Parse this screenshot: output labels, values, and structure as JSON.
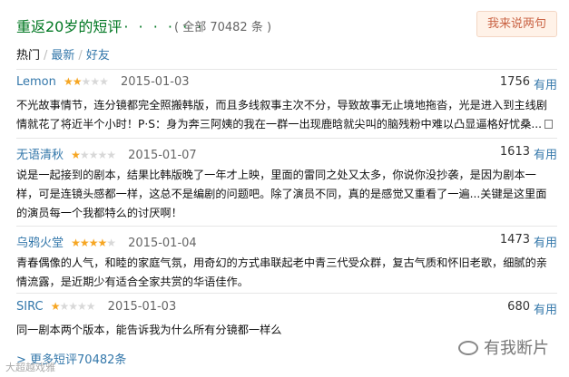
{
  "header": {
    "title": "重返20岁的短评",
    "dots": "· · · · · ·",
    "total": "( 全部 70482 条 )",
    "say_button": "我来说两句"
  },
  "sorts": {
    "hot": "热门",
    "sep": "/",
    "latest": "最新",
    "friends": "好友"
  },
  "comments": [
    {
      "user": "Lemon",
      "rating": 2,
      "date": "2015-01-03",
      "votes": "1756",
      "useful": "有用",
      "text": "不光故事情节，连分镜都完全照搬韩版，而且多线叙事主次不分，导致故事无止境地拖沓，光是进入到主线剧情就花了将近半个小时！P·S：身为奔三阿姨的我在一群一出现鹿晗就尖叫的脑残粉中难以凸显逼格好忧桑..."
    },
    {
      "user": "无语清秋",
      "rating": 1,
      "date": "2015-01-07",
      "votes": "1613",
      "useful": "有用",
      "text": "说是一起接到的剧本，结果比韩版晚了一年才上映，里面的雷同之处又太多，你说你没抄袭，是因为剧本一样，可是连镜头感都一样，这总不是编剧的问题吧。除了演员不同，真的是感觉又重看了一遍...关键是这里面的演员每一个我都特么的讨厌啊！"
    },
    {
      "user": "乌鸦火堂",
      "rating": 4,
      "date": "2015-01-04",
      "votes": "1473",
      "useful": "有用",
      "text": "青春偶像的人气，和睦的家庭气氛，用奇幻的方式串联起老中青三代受众群，复古气质和怀旧老歌，细腻的亲情流露，是近期少有适合全家共赏的华语佳作。"
    },
    {
      "user": "SIRC",
      "rating": 1,
      "date": "2015-01-03",
      "votes": "680",
      "useful": "有用",
      "text": "同一剧本两个版本，能告诉我为什么所有分镜都一样么"
    }
  ],
  "more_link": "> 更多短评70482条",
  "watermark": "有我断片",
  "watermark2": "大超越戏雅"
}
